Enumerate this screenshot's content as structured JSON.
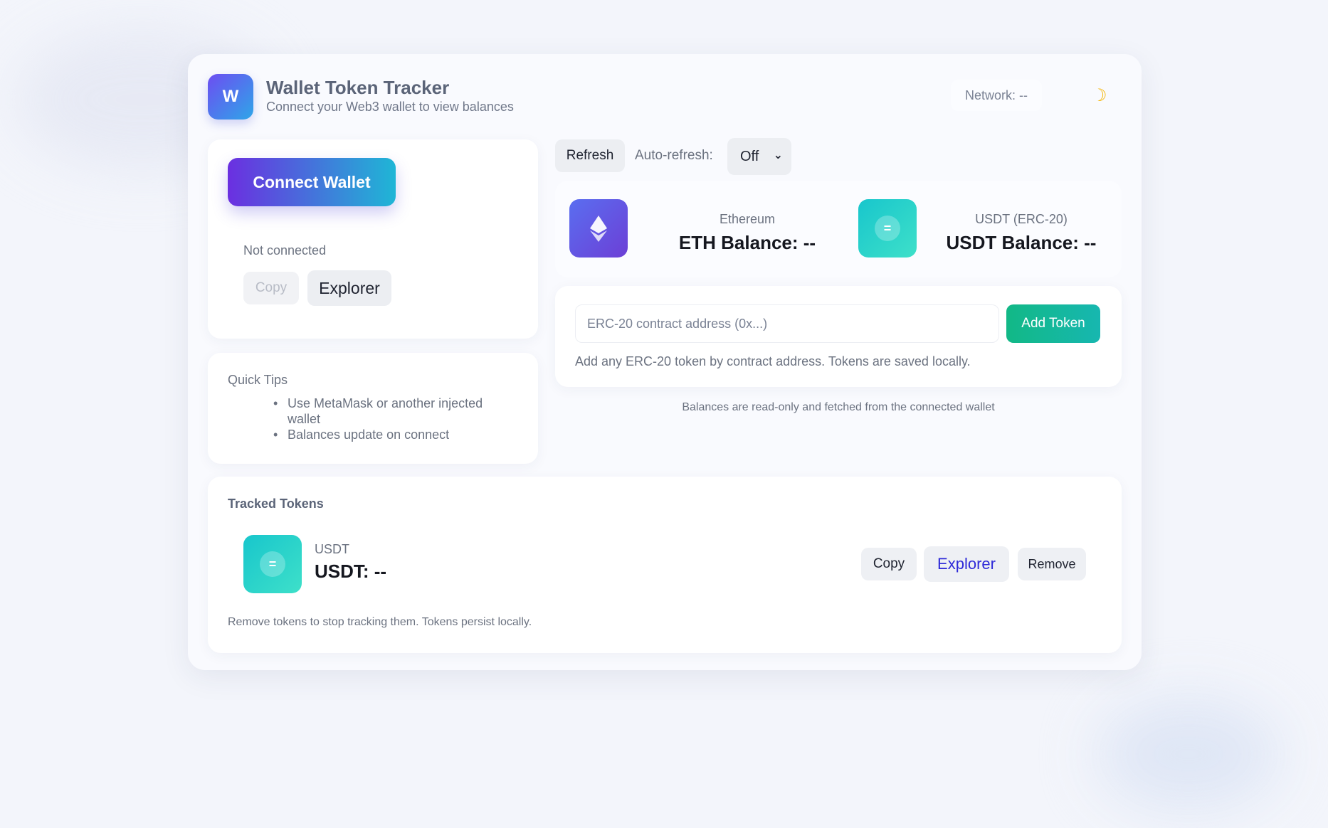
{
  "header": {
    "logo_letter": "W",
    "title": "Wallet Token Tracker",
    "subtitle": "Connect your Web3 wallet to view balances",
    "network": "Network: --",
    "theme_icon": "moon-icon"
  },
  "connect": {
    "button_label": "Connect Wallet",
    "status": "Not connected",
    "copy_label": "Copy",
    "explorer_label": "Explorer"
  },
  "tips": {
    "title": "Quick Tips",
    "items": [
      "Use MetaMask or another injected wallet",
      "Balances update on connect"
    ]
  },
  "controls": {
    "refresh_label": "Refresh",
    "auto_refresh_label": "Auto-refresh:",
    "auto_refresh_value": "Off"
  },
  "balances": {
    "eth": {
      "label": "Ethereum",
      "value": "ETH Balance: --",
      "icon": "ethereum-icon"
    },
    "usdt": {
      "label": "USDT (ERC-20)",
      "value": "USDT Balance: --",
      "icon": "usdt-icon"
    }
  },
  "add_token": {
    "placeholder": "ERC-20 contract address (0x...)",
    "button_label": "Add Token",
    "hint": "Add any ERC-20 token by contract address. Tokens are saved locally."
  },
  "readonly_note": "Balances are read-only and fetched from the connected wallet",
  "tracked": {
    "title": "Tracked Tokens",
    "tokens": [
      {
        "symbol": "USDT",
        "value": "USDT: --",
        "copy": "Copy",
        "explorer": "Explorer",
        "remove": "Remove"
      }
    ],
    "note": "Remove tokens to stop tracking them. Tokens persist locally."
  },
  "colors": {
    "accent_gradient_start": "#6b2fe0",
    "accent_gradient_end": "#1fb6d6",
    "add_token_green": "#12b886",
    "explorer_link": "#2e2ad8"
  }
}
